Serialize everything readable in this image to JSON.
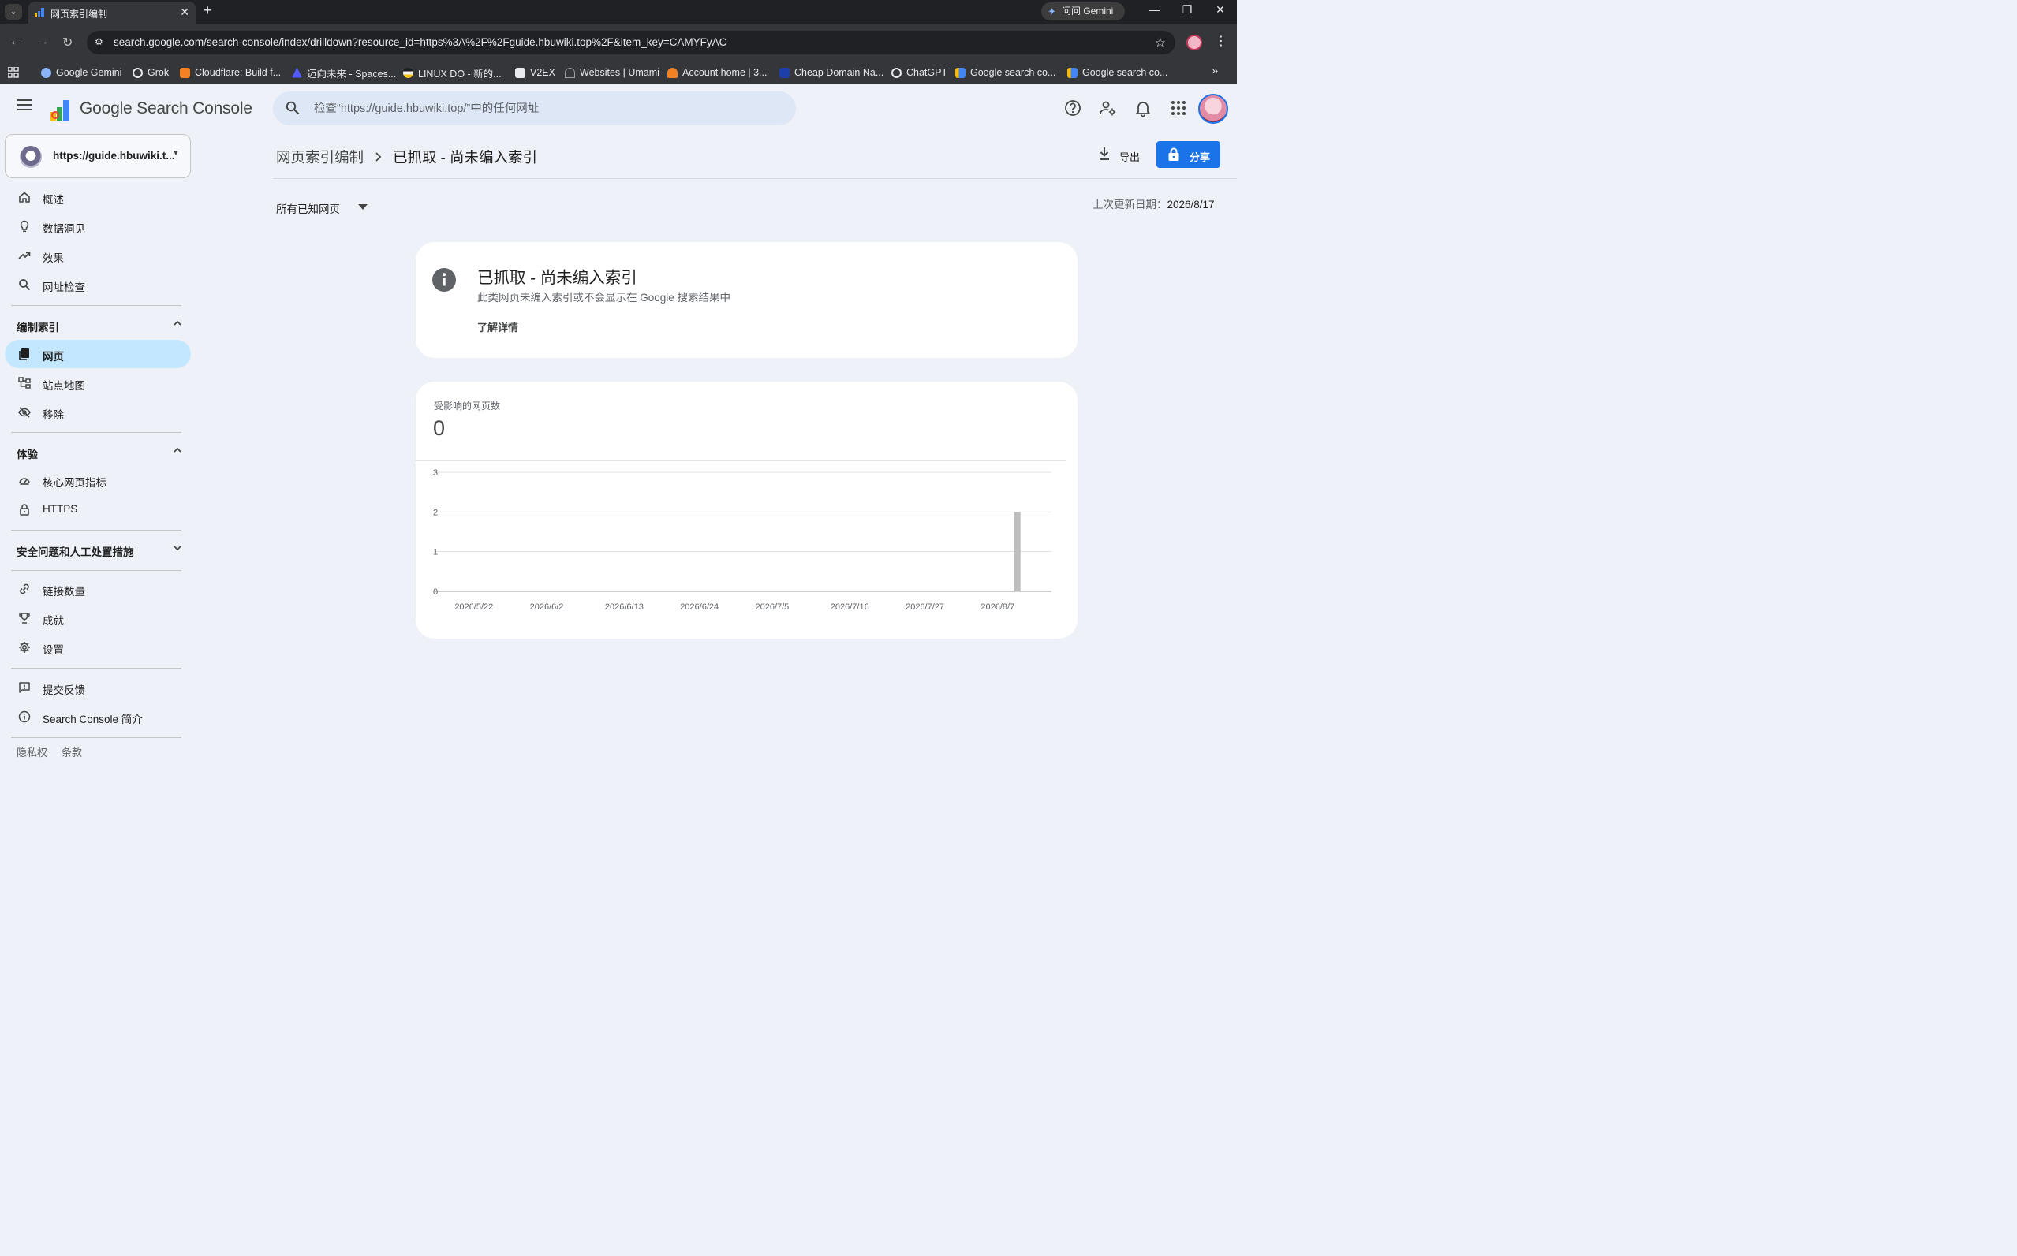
{
  "browser": {
    "tab_title": "网页索引编制",
    "new_tab_symbol": "+",
    "gemini_label": "问问 Gemini",
    "url": "search.google.com/search-console/index/drilldown?resource_id=https%3A%2F%2Fguide.hbuwiki.top%2F&item_key=CAMYFyAC",
    "bookmarks": [
      {
        "label": "Google Gemini",
        "icon": "gemini-icon",
        "color": "#8ab4f8"
      },
      {
        "label": "Grok",
        "icon": "grok-icon",
        "color": "#e8eaed"
      },
      {
        "label": "Cloudflare: Build f...",
        "icon": "cloudflare-icon",
        "color": "#f48120"
      },
      {
        "label": "迈向未来 - Spaces...",
        "icon": "spaces-icon",
        "color": "#4f5bff"
      },
      {
        "label": "LINUX DO - 新的...",
        "icon": "linuxdo-icon",
        "color": "#f5c518"
      },
      {
        "label": "V2EX",
        "icon": "v2ex-icon",
        "color": "#e8eaed"
      },
      {
        "label": "Websites | Umami",
        "icon": "umami-icon",
        "color": "#9aa0a6"
      },
      {
        "label": "Account home | 3...",
        "icon": "cloudflare-icon",
        "color": "#f48120"
      },
      {
        "label": "Cheap Domain Na...",
        "icon": "domain-icon",
        "color": "#1d3fa8"
      },
      {
        "label": "ChatGPT",
        "icon": "chatgpt-icon",
        "color": "#e8eaed"
      },
      {
        "label": "Google search co...",
        "icon": "search-console-icon",
        "color": "#fbbc04"
      },
      {
        "label": "Google search co...",
        "icon": "search-console-icon",
        "color": "#fbbc04"
      }
    ]
  },
  "header": {
    "logo_text": "Google Search Console",
    "search_placeholder": "检查“https://guide.hbuwiki.top/”中的任何网址"
  },
  "sidebar": {
    "property_url": "https://guide.hbuwiki.t...",
    "top_items": [
      {
        "label": "概述",
        "icon": "home-icon"
      },
      {
        "label": "数据洞见",
        "icon": "lightbulb-icon"
      },
      {
        "label": "效果",
        "icon": "trending-up-icon"
      },
      {
        "label": "网址检查",
        "icon": "search-icon"
      }
    ],
    "index_section": {
      "label": "编制索引",
      "items": [
        {
          "label": "网页",
          "icon": "pages-icon",
          "active": true
        },
        {
          "label": "站点地图",
          "icon": "sitemap-icon"
        },
        {
          "label": "移除",
          "icon": "visibility-off-icon"
        }
      ]
    },
    "experience_section": {
      "label": "体验",
      "items": [
        {
          "label": "核心网页指标",
          "icon": "speed-icon"
        },
        {
          "label": "HTTPS",
          "icon": "lock-icon"
        }
      ]
    },
    "security_section": {
      "label": "安全问题和人工处置措施"
    },
    "bottom_items": [
      {
        "label": "链接数量",
        "icon": "link-icon"
      },
      {
        "label": "成就",
        "icon": "trophy-icon"
      },
      {
        "label": "设置",
        "icon": "gear-icon"
      }
    ],
    "footer_items": [
      {
        "label": "提交反馈",
        "icon": "feedback-icon"
      },
      {
        "label": "Search Console 简介",
        "icon": "info-icon"
      }
    ],
    "legal": {
      "privacy": "隐私权",
      "terms": "条款"
    }
  },
  "main": {
    "breadcrumb_parent": "网页索引编制",
    "breadcrumb_current": "已抓取 - 尚未编入索引",
    "export_label": "导出",
    "share_label": "分享",
    "filter_label": "所有已知网页",
    "updated_label": "上次更新日期：",
    "updated_value": "2026/8/17",
    "info_title": "已抓取 - 尚未编入索引",
    "info_description": "此类网页未编入索引或不会显示在 Google 搜索结果中",
    "learn_more": "了解详情",
    "kpi_label": "受影响的网页数",
    "kpi_value": "0"
  },
  "colors": {
    "accent": "#1a73e8",
    "active_nav": "#c2e7ff",
    "page_bg": "#eef2f8",
    "bar": "#bdbdbd"
  },
  "chart_data": {
    "type": "bar",
    "y_ticks": [
      "0",
      "1",
      "2",
      "3"
    ],
    "ylim": [
      0,
      3
    ],
    "x_tick_labels": [
      "2026/5/22",
      "2026/6/2",
      "2026/6/13",
      "2026/6/24",
      "2026/7/5",
      "2026/7/16",
      "2026/7/27",
      "2026/8/7"
    ],
    "x_range": [
      "2026/5/20",
      "2026/8/17"
    ],
    "bars": [
      {
        "date": "2026/8/12",
        "value": 2
      }
    ],
    "grid": true
  }
}
